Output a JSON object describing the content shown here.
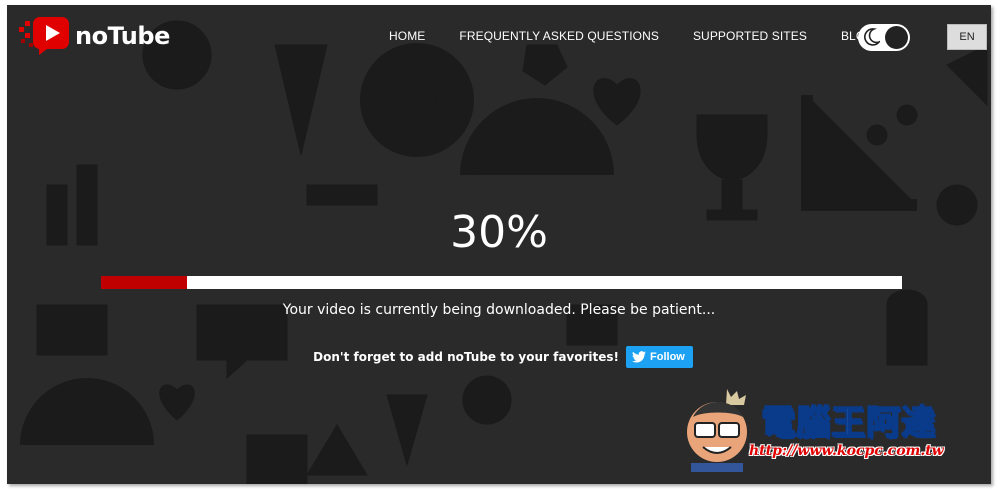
{
  "brand": {
    "name": "noTube",
    "accent": "#e00000"
  },
  "nav": {
    "items": [
      {
        "label": "HOME"
      },
      {
        "label": "FREQUENTLY ASKED QUESTIONS"
      },
      {
        "label": "SUPPORTED SITES"
      },
      {
        "label": "BLOG"
      }
    ]
  },
  "theme_toggle": {
    "icon": "moon-icon",
    "state": "dark"
  },
  "language": {
    "label": "EN"
  },
  "download": {
    "percent_label": "30%",
    "progress": 0.107,
    "bar_fill_color": "#c00000",
    "status_text": "Your video is currently being downloaded. Please be patient..."
  },
  "favorites": {
    "text": "Don't forget to add noTube to your favorites!",
    "follow_label": "Follow",
    "follow_color": "#1da1f2"
  },
  "watermark": {
    "title": "電腦王阿達",
    "url": "http://www.kocpc.com.tw"
  }
}
